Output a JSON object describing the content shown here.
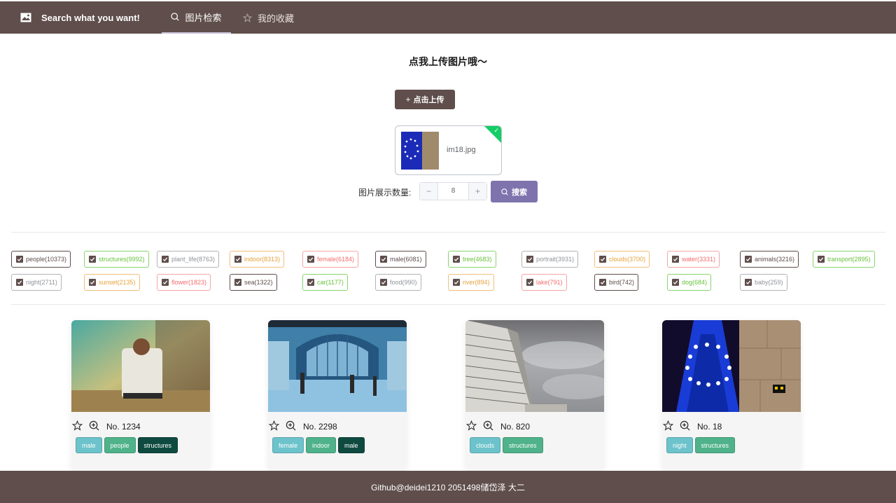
{
  "header": {
    "title": "Search what you want!",
    "tabs": [
      {
        "label": "图片检索",
        "icon": "search-icon",
        "active": true
      },
      {
        "label": "我的收藏",
        "icon": "star-icon",
        "active": false
      }
    ],
    "bg_color": "#5f4e4b"
  },
  "upload": {
    "title": "点我上传图片哦～",
    "button_label": "点击上传",
    "file_name": "im18.jpg",
    "status": "success"
  },
  "search": {
    "count_label": "图片展示数量:",
    "count_value": "8",
    "stepper_minus": "−",
    "stepper_plus": "+",
    "button_label": "搜索",
    "button_color": "#7f73ad"
  },
  "tags": [
    {
      "label": "people(10373)",
      "color": "dark"
    },
    {
      "label": "structures(9992)",
      "color": "green"
    },
    {
      "label": "plant_life(8763)",
      "color": "gray"
    },
    {
      "label": "indoor(8313)",
      "color": "orange"
    },
    {
      "label": "female(6184)",
      "color": "red"
    },
    {
      "label": "male(6081)",
      "color": "dark"
    },
    {
      "label": "tree(4683)",
      "color": "green"
    },
    {
      "label": "portrait(3931)",
      "color": "gray"
    },
    {
      "label": "clouds(3700)",
      "color": "orange"
    },
    {
      "label": "water(3331)",
      "color": "red"
    },
    {
      "label": "animals(3216)",
      "color": "dark"
    },
    {
      "label": "transport(2895)",
      "color": "green"
    },
    {
      "label": "night(2711)",
      "color": "gray"
    },
    {
      "label": "sunset(2135)",
      "color": "orange"
    },
    {
      "label": "flower(1823)",
      "color": "red"
    },
    {
      "label": "sea(1322)",
      "color": "dark"
    },
    {
      "label": "car(1177)",
      "color": "green"
    },
    {
      "label": "food(990)",
      "color": "gray"
    },
    {
      "label": "river(894)",
      "color": "orange"
    },
    {
      "label": "lake(791)",
      "color": "red"
    },
    {
      "label": "bird(742)",
      "color": "dark"
    },
    {
      "label": "dog(684)",
      "color": "green"
    },
    {
      "label": "baby(259)",
      "color": "gray"
    }
  ],
  "results": [
    {
      "number": "No. 1234",
      "image": "man-in-field-photo",
      "tags": [
        {
          "label": "male",
          "color": "blue"
        },
        {
          "label": "people",
          "color": "green"
        },
        {
          "label": "structures",
          "color": "dark"
        }
      ]
    },
    {
      "number": "No. 2298",
      "image": "station-hall-photo",
      "tags": [
        {
          "label": "female",
          "color": "blue"
        },
        {
          "label": "indoor",
          "color": "green"
        },
        {
          "label": "male",
          "color": "dark"
        }
      ]
    },
    {
      "number": "No. 820",
      "image": "building-clouds-photo",
      "tags": [
        {
          "label": "clouds",
          "color": "blue"
        },
        {
          "label": "structures",
          "color": "green"
        }
      ]
    },
    {
      "number": "No. 18",
      "image": "eiffel-blue-night-photo",
      "tags": [
        {
          "label": "night",
          "color": "blue"
        },
        {
          "label": "structures",
          "color": "green"
        }
      ]
    }
  ],
  "footer": {
    "text": "Github@deidei1210 2051498储岱泽 大二"
  }
}
